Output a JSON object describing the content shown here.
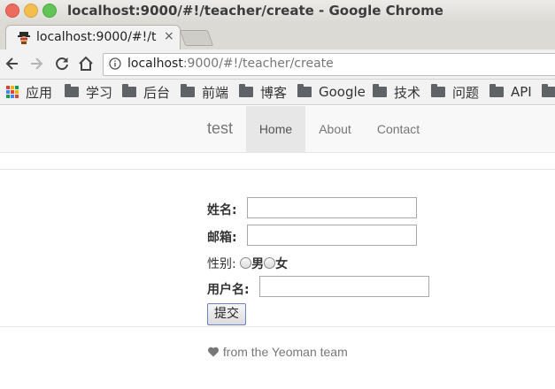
{
  "window": {
    "title": "localhost:9000/#!/teacher/create - Google Chrome"
  },
  "tab": {
    "label": "localhost:9000/#!/t",
    "close_glyph": "×"
  },
  "toolbar": {
    "url_host": "localhost",
    "url_rest": ":9000/#!/teacher/create"
  },
  "bookmarks": {
    "items": [
      {
        "label": "应用",
        "icon": "apps-icon"
      },
      {
        "label": "学习",
        "icon": "folder-icon"
      },
      {
        "label": "后台",
        "icon": "folder-icon"
      },
      {
        "label": "前端",
        "icon": "folder-icon"
      },
      {
        "label": "博客",
        "icon": "folder-icon"
      },
      {
        "label": "Google",
        "icon": "folder-icon"
      },
      {
        "label": "技术",
        "icon": "folder-icon"
      },
      {
        "label": "问题",
        "icon": "folder-icon"
      },
      {
        "label": "API",
        "icon": "folder-icon"
      }
    ]
  },
  "navbar": {
    "brand": "test",
    "items": [
      {
        "label": "Home",
        "active": true
      },
      {
        "label": "About",
        "active": false
      },
      {
        "label": "Contact",
        "active": false
      }
    ]
  },
  "form": {
    "name_label": "姓名:",
    "name_value": "",
    "email_label": "邮箱:",
    "email_value": "",
    "gender_label": "性别:",
    "gender_male": "男",
    "gender_female": "女",
    "username_label": "用户名:",
    "username_value": "",
    "submit_label": "提交"
  },
  "footer": {
    "text": "from the Yeoman team",
    "icon": "heart-icon"
  },
  "colors": {
    "nav_active_bg": "#e7e7e7",
    "navbar_bg": "#f8f8f8",
    "text_muted": "#777777"
  }
}
